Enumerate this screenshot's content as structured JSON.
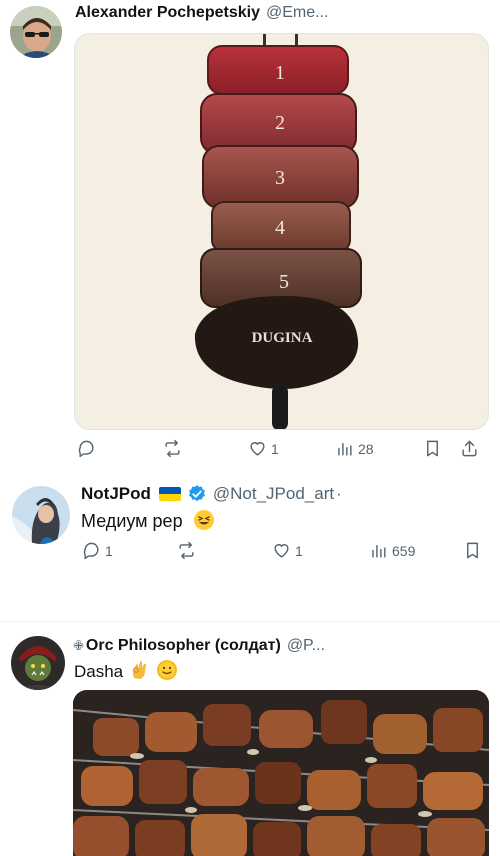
{
  "tweet1": {
    "author": "Alexander Pochepetskiy",
    "handle": "@Eme...",
    "image_label": "DUGINA",
    "steak_numbers": [
      "1",
      "2",
      "3",
      "4",
      "5"
    ],
    "actions": {
      "reply": "",
      "retweet": "",
      "like": "1",
      "views": "28"
    },
    "icons": [
      "reply-icon",
      "retweet-icon",
      "like-icon",
      "views-icon",
      "bookmark-icon",
      "share-icon"
    ]
  },
  "tweet2": {
    "author": "NotJPod",
    "handle": "@Not_JPod_art",
    "separator": "·",
    "text": "Медиум рер",
    "actions": {
      "reply": "1",
      "retweet": "",
      "like": "1",
      "views": "659"
    },
    "flag_colors": [
      "#0057b7",
      "#ffd700"
    ],
    "verified_color": "#1d9bf0"
  },
  "tweet3": {
    "author": "Orc Philosopher (солдат)",
    "handle": "@P...",
    "prefix_symbol": "✙",
    "text": "Dasha",
    "emoji": [
      "ok-hand-emoji",
      "smiling-face-emoji"
    ]
  }
}
